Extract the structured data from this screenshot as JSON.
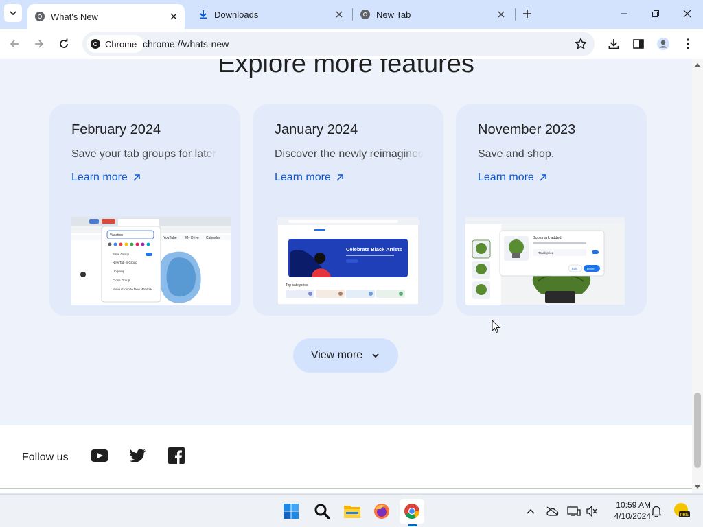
{
  "browser": {
    "tabs": [
      {
        "title": "What's New",
        "icon": "chrome-icon",
        "active": true
      },
      {
        "title": "Downloads",
        "icon": "download-icon",
        "active": false
      },
      {
        "title": "New Tab",
        "icon": "chrome-icon",
        "active": false
      }
    ],
    "omnibox": {
      "chip_label": "Chrome",
      "url": "chrome://whats-new"
    }
  },
  "page": {
    "section_title": "Explore more features",
    "cards": [
      {
        "date": "February 2024",
        "description": "Save your tab groups for later",
        "link": "Learn more"
      },
      {
        "date": "January 2024",
        "description": "Discover the newly reimagined",
        "link": "Learn more"
      },
      {
        "date": "November 2023",
        "description": "Save and shop.",
        "link": "Learn more"
      }
    ],
    "view_more": "View more",
    "footer": {
      "follow_label": "Follow us",
      "social": [
        "youtube-icon",
        "twitter-icon",
        "facebook-icon"
      ]
    }
  },
  "illustrations": {
    "feb": {
      "tab_label": "Vacation",
      "menu": [
        "Save Group",
        "New Tab in Group",
        "Ungroup",
        "Close Group",
        "Move Group to New Window"
      ],
      "bookmarks": [
        "YouTube",
        "My Drive",
        "Calendar"
      ]
    },
    "jan": {
      "banner_title": "Celebrate Black Artists",
      "section_label": "Top categories"
    },
    "nov": {
      "popup_title": "Bookmark added",
      "toggle_label": "Track price",
      "edit_label": "Edit",
      "done_label": "Done"
    }
  },
  "taskbar": {
    "clock_time": "10:59 AM",
    "clock_date": "4/10/2024",
    "apps": [
      "windows-start-icon",
      "search-icon",
      "file-explorer-icon",
      "firefox-icon",
      "chrome-icon"
    ],
    "badge": "PRE"
  },
  "colors": {
    "accent": "#0b57d0",
    "card_bg": "#e3ebfa",
    "page_bg": "#edf2fb",
    "tabstrip_bg": "#d3e3fd"
  }
}
